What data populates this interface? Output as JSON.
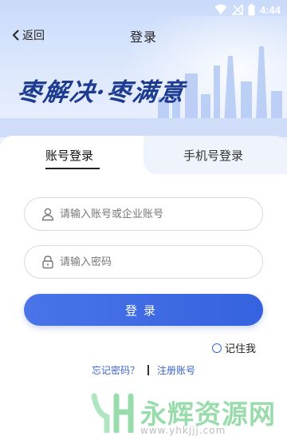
{
  "status_bar": {
    "time": "4:44"
  },
  "header": {
    "back_label": "返回",
    "title": "登录"
  },
  "banner": {
    "slogan": "枣解决·枣满意"
  },
  "tabs": [
    {
      "label": "账号登录",
      "active": true
    },
    {
      "label": "手机号登录",
      "active": false
    }
  ],
  "form": {
    "account_placeholder": "请输入账号或企业账号",
    "account_value": "",
    "password_placeholder": "请输入密码",
    "password_value": "",
    "submit_label": "登录",
    "remember_label": "记住我",
    "remember_checked": false
  },
  "links": {
    "forgot": "忘记密码？",
    "register": "注册账号"
  },
  "watermark": {
    "text": "永辉资源网",
    "url": "www.yhkjjj.com"
  },
  "colors": {
    "primary": "#3a66e0",
    "link": "#3b63c8",
    "slogan": "#1d3b8f",
    "watermark": "#47c06a"
  }
}
